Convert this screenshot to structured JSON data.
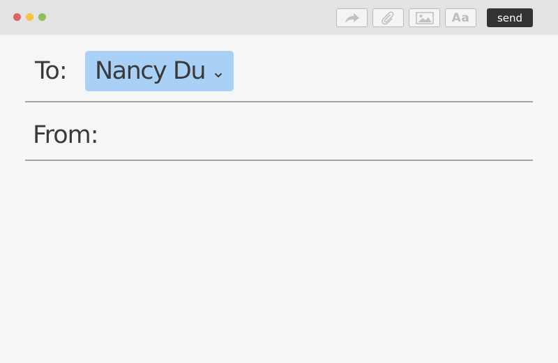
{
  "window": {
    "traffic_lights": {
      "close": "#e06161",
      "minimize": "#f4c542",
      "maximize": "#8cc15a"
    }
  },
  "toolbar": {
    "forward_icon": "forward-arrow-icon",
    "attach_icon": "paperclip-icon",
    "image_icon": "image-icon",
    "font_icon": "font-icon",
    "font_glyph": "Aa",
    "send_label": "send"
  },
  "compose": {
    "to_label": "To:",
    "recipient": "Nancy Du",
    "from_label": "From:",
    "from_value": "",
    "body": ""
  },
  "colors": {
    "recipient_chip": "#a8d1f5",
    "send_button": "#333333",
    "background": "#f6f6f6",
    "titlebar": "#e3e3e3"
  }
}
